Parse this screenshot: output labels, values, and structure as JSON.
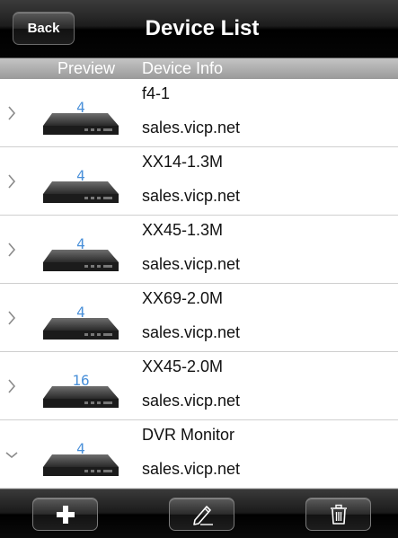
{
  "header": {
    "back_label": "Back",
    "title": "Device List"
  },
  "columns": {
    "preview": "Preview",
    "device_info": "Device Info"
  },
  "devices": [
    {
      "name": "f4-1",
      "host": "sales.vicp.net",
      "channels": "4",
      "expanded": false
    },
    {
      "name": "XX14-1.3M",
      "host": "sales.vicp.net",
      "channels": "4",
      "expanded": false
    },
    {
      "name": "XX45-1.3M",
      "host": "sales.vicp.net",
      "channels": "4",
      "expanded": false
    },
    {
      "name": "XX69-2.0M",
      "host": "sales.vicp.net",
      "channels": "4",
      "expanded": false
    },
    {
      "name": "XX45-2.0M",
      "host": "sales.vicp.net",
      "channels": "16",
      "expanded": false
    },
    {
      "name": "DVR Monitor",
      "host": "sales.vicp.net",
      "channels": "4",
      "expanded": true
    }
  ],
  "toolbar": {
    "icons": [
      "plus-icon",
      "pencil-icon",
      "trash-icon"
    ]
  },
  "colors": {
    "header_bg": "#000000",
    "column_header_bg": "#a8a8a8",
    "channel_digit": "#4a90d9"
  }
}
